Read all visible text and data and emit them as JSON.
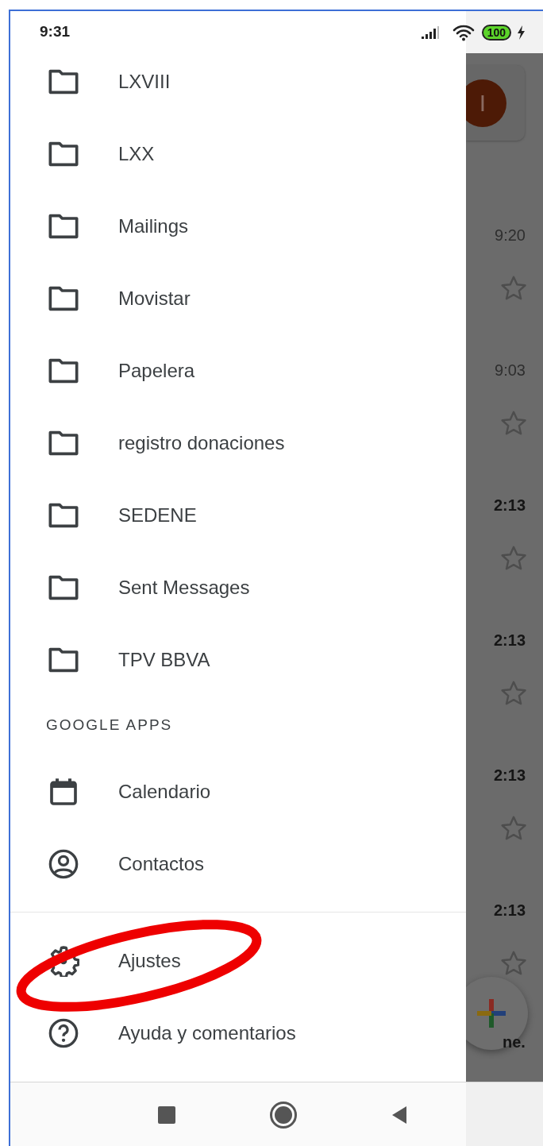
{
  "status_bar": {
    "time": "9:31",
    "battery": "100"
  },
  "drawer": {
    "folders": [
      {
        "label": "LXVIII"
      },
      {
        "label": "LXX"
      },
      {
        "label": "Mailings"
      },
      {
        "label": "Movistar"
      },
      {
        "label": "Papelera"
      },
      {
        "label": "registro donaciones"
      },
      {
        "label": "SEDENE"
      },
      {
        "label": "Sent Messages"
      },
      {
        "label": "TPV BBVA"
      }
    ],
    "section_header": "GOOGLE APPS",
    "apps": [
      {
        "kind": "calendar",
        "label": "Calendario"
      },
      {
        "kind": "contacts",
        "label": "Contactos"
      }
    ],
    "footer_items": [
      {
        "kind": "settings",
        "label": "Ajustes"
      },
      {
        "kind": "help",
        "label": "Ayuda y comentarios"
      }
    ]
  },
  "inbox_behind": {
    "avatar_letter": "I",
    "emails": [
      {
        "time": "9:20",
        "unread": false,
        "starred": false
      },
      {
        "time": "9:03",
        "unread": false,
        "starred": false
      },
      {
        "time": "2:13",
        "unread": true,
        "starred": false
      },
      {
        "time": "2:13",
        "unread": true,
        "starred": false
      },
      {
        "time": "2:13",
        "unread": true,
        "starred": false
      },
      {
        "time": "2:13",
        "unread": true,
        "starred": false
      }
    ],
    "fragment": "ne."
  },
  "annotations": [
    {
      "kind": "ellipse"
    }
  ]
}
